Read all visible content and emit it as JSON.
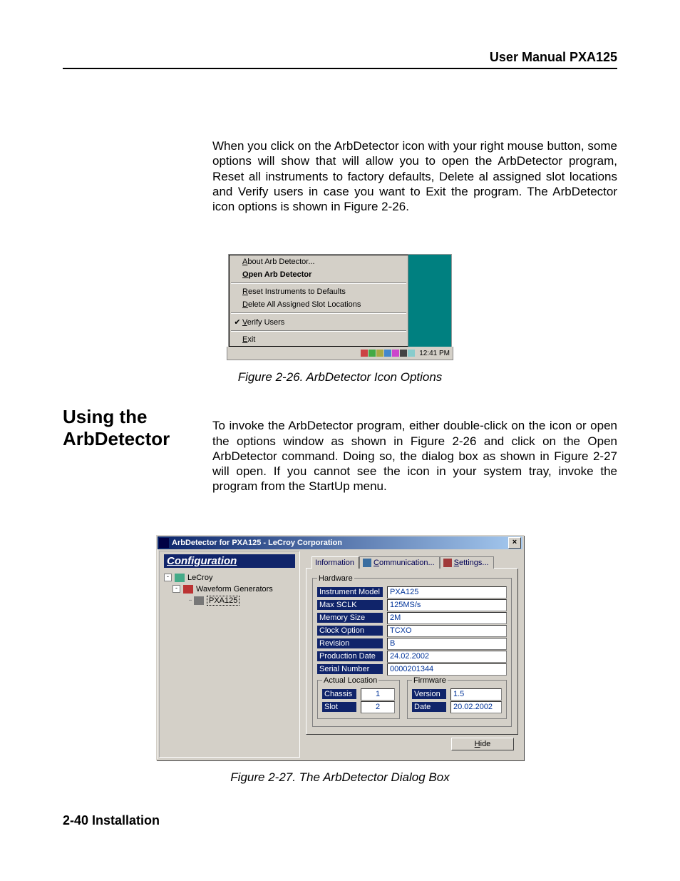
{
  "header": {
    "title": "User Manual PXA125"
  },
  "intro_paragraph": "When you click on the ArbDetector icon with your right mouse button, some options will show that will allow you to open the ArbDetector program, Reset all instruments to factory defaults, Delete al assigned slot locations and Verify users in case you want to Exit the program. The ArbDetector icon options is shown in Figure 2-26.",
  "context_menu": {
    "items": [
      {
        "label": "About Arb Detector...",
        "checked": false,
        "bold": false
      },
      {
        "label": "Open Arb Detector",
        "checked": false,
        "bold": true
      },
      {
        "separator": true
      },
      {
        "label": "Reset Instruments to Defaults",
        "checked": false,
        "bold": false
      },
      {
        "label": "Delete All Assigned Slot Locations",
        "checked": false,
        "bold": false
      },
      {
        "separator": true
      },
      {
        "label": "Verify Users",
        "checked": true,
        "bold": false
      },
      {
        "separator": true
      },
      {
        "label": "Exit",
        "checked": false,
        "bold": false
      }
    ],
    "tray_time": "12:41 PM"
  },
  "caption1": "Figure 2-26. ArbDetector Icon Options",
  "section_heading": "Using the ArbDetector",
  "section_paragraph": "To invoke the ArbDetector program, either double-click on the icon or open the options window as shown in Figure 2-26 and click on the Open ArbDetector command. Doing so, the dialog box as shown in Figure 2-27 will open. If you cannot see the icon in your system tray, invoke the program from the StartUp menu.",
  "dialog": {
    "title": "ArbDetector for PXA125 - LeCroy Corporation",
    "left_title": "Configuration",
    "tree": {
      "root": "LeCroy",
      "child": "Waveform Generators",
      "leaf": "PXA125"
    },
    "tabs": [
      "Information",
      "Communication...",
      "Settings..."
    ],
    "hardware_legend": "Hardware",
    "hardware": [
      {
        "label": "Instrument Model",
        "value": "PXA125"
      },
      {
        "label": "Max SCLK",
        "value": "125MS/s"
      },
      {
        "label": "Memory Size",
        "value": "2M"
      },
      {
        "label": "Clock Option",
        "value": "TCXO"
      },
      {
        "label": "Revision",
        "value": "B"
      },
      {
        "label": "Production Date",
        "value": "24.02.2002"
      },
      {
        "label": "Serial Number",
        "value": "0000201344"
      }
    ],
    "location_legend": "Actual  Location",
    "location": [
      {
        "label": "Chassis",
        "value": "1"
      },
      {
        "label": "Slot",
        "value": "2"
      }
    ],
    "firmware_legend": "Firmware",
    "firmware": [
      {
        "label": "Version",
        "value": "1.5"
      },
      {
        "label": "Date",
        "value": "20.02.2002"
      }
    ],
    "hide_button": "Hide"
  },
  "caption2": "Figure 2-27. The ArbDetector Dialog Box",
  "footer": "2-40 Installation"
}
